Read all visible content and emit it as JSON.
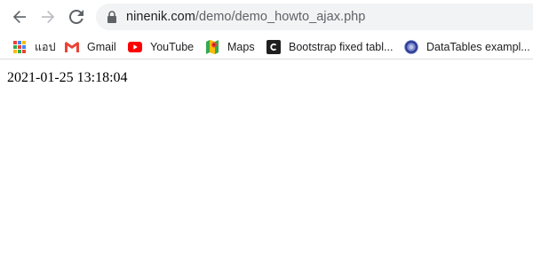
{
  "toolbar": {
    "url_host": "ninenik.com",
    "url_path": "/demo/demo_howto_ajax.php",
    "back_icon": "back-arrow-icon",
    "forward_icon": "forward-arrow-icon",
    "reload_icon": "reload-icon",
    "lock_icon": "lock-icon"
  },
  "bookmarks": [
    {
      "label": "แอป",
      "icon": "apps-grid-icon"
    },
    {
      "label": "Gmail",
      "icon": "gmail-icon"
    },
    {
      "label": "YouTube",
      "icon": "youtube-icon"
    },
    {
      "label": "Maps",
      "icon": "maps-icon"
    },
    {
      "label": "Bootstrap fixed tabl...",
      "icon": "bootstrap-c-icon"
    },
    {
      "label": "DataTables exampl...",
      "icon": "datatables-icon"
    }
  ],
  "page": {
    "datetime": "2021-01-25 13:18:04"
  },
  "colors": {
    "omnibox_bg": "#f1f3f4",
    "text": "#202124",
    "path_text": "#5f6368",
    "icon": "#5f6368",
    "youtube_red": "#ff0000",
    "gmail_red": "#ea4335"
  }
}
